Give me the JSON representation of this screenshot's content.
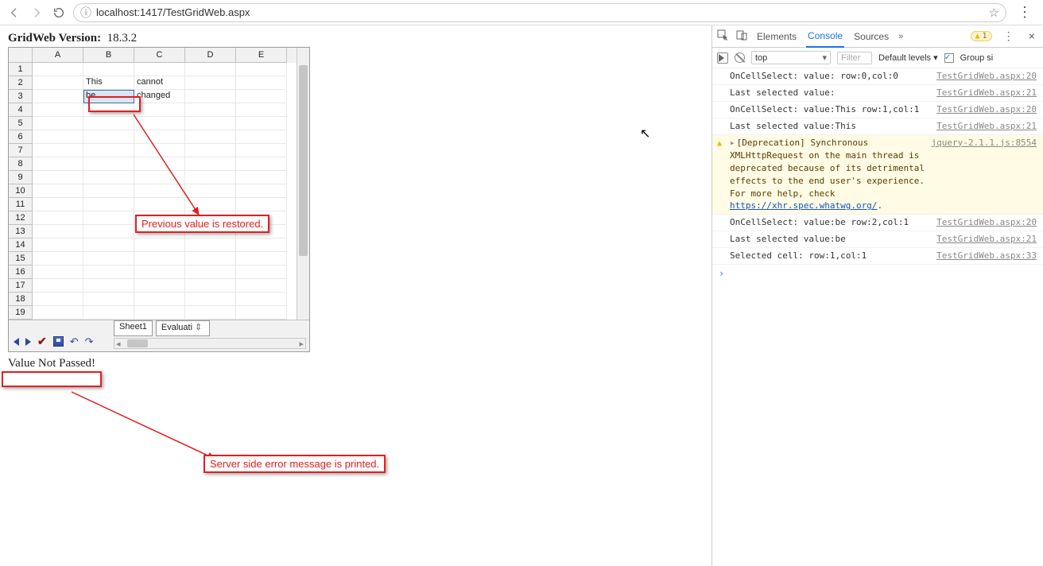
{
  "browser": {
    "url": "localhost:1417/TestGridWeb.aspx"
  },
  "version": {
    "label": "GridWeb Version:",
    "value": "18.3.2"
  },
  "grid": {
    "columns": [
      "A",
      "B",
      "C",
      "D",
      "E"
    ],
    "row_count": 19,
    "cells": {
      "r2": {
        "B": "This",
        "C": "cannot"
      },
      "r3": {
        "B": "be",
        "C": "changed"
      }
    },
    "selected": "B3",
    "tabs": [
      "Sheet1",
      "Evaluati"
    ]
  },
  "message": "Value Not Passed!",
  "annotations": {
    "a1": "Previous value is restored.",
    "a2": "Server side error message is printed."
  },
  "devtools": {
    "tabs": [
      "Elements",
      "Console",
      "Sources"
    ],
    "active_tab": "Console",
    "warn_count": "1",
    "context": "top",
    "filter_placeholder": "Filter",
    "levels_label": "Default levels ▾",
    "group_label": "Group si",
    "logs": [
      {
        "type": "log",
        "msg": "OnCellSelect: value: row:0,col:0",
        "src": "TestGridWeb.aspx:20"
      },
      {
        "type": "log",
        "msg": "Last selected value:",
        "src": "TestGridWeb.aspx:21"
      },
      {
        "type": "log",
        "msg": "OnCellSelect: value:This row:1,col:1",
        "src": "TestGridWeb.aspx:20"
      },
      {
        "type": "log",
        "msg": "Last selected value:This",
        "src": "TestGridWeb.aspx:21"
      },
      {
        "type": "warn",
        "msg": "[Deprecation] Synchronous XMLHttpRequest on the main thread is deprecated because of its detrimental effects to the end user's experience. For more help, check ",
        "link": "https://xhr.spec.whatwg.org/",
        "src": "jquery-2.1.1.js:8554"
      },
      {
        "type": "log",
        "msg": "OnCellSelect: value:be row:2,col:1",
        "src": "TestGridWeb.aspx:20"
      },
      {
        "type": "log",
        "msg": "Last selected value:be",
        "src": "TestGridWeb.aspx:21"
      },
      {
        "type": "log",
        "msg": "Selected cell: row:1,col:1",
        "src": "TestGridWeb.aspx:33"
      }
    ]
  }
}
